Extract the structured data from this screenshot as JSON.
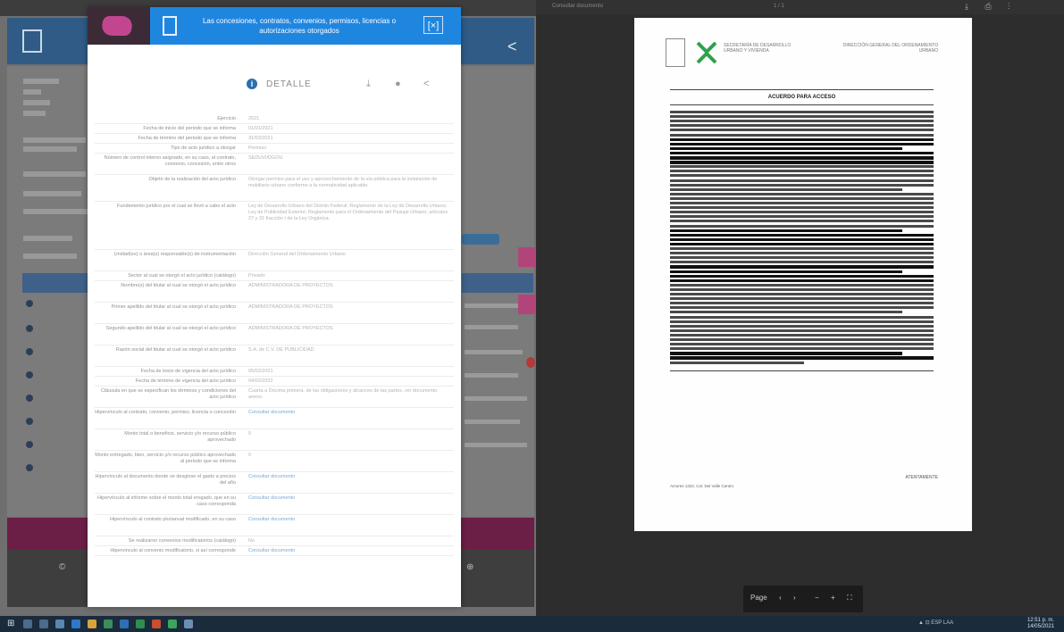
{
  "modal": {
    "title": "Las concesiones, contratos, convenios, permisos, licencias o autorizaciones otorgados",
    "close_label": "[×]",
    "tab_label": "DETALLE",
    "info_icon": "i",
    "share_icon": "<",
    "fields": [
      {
        "label": "Ejercicio",
        "value": "2021",
        "h": 11
      },
      {
        "label": "Fecha de inicio del periodo que se informa",
        "value": "01/01/2021",
        "h": 11
      },
      {
        "label": "Fecha de término del periodo que se informa",
        "value": "31/03/2021",
        "h": 11
      },
      {
        "label": "Tipo de acto jurídico a otorgar",
        "value": "Permiso",
        "h": 11
      },
      {
        "label": "Número de control interno asignado, en su caso, al contrato, convenio, concesión, entre otros",
        "value": "SEDUVI/DGOU",
        "h": 24
      },
      {
        "label": "Objeto de la realización del acto jurídico",
        "value": "Otorgar permiso para el uso y aprovechamiento de la vía pública para la instalación de mobiliario urbano conforme a la normatividad aplicable.",
        "h": 30
      },
      {
        "label": "Fundamento jurídico por el cual se llevó a cabo el acto",
        "value": "Ley de Desarrollo Urbano del Distrito Federal; Reglamento de la Ley de Desarrollo Urbano; Ley de Publicidad Exterior; Reglamento para el Ordenamiento del Paisaje Urbano; artículos 27 y 31 fracción I de la Ley Orgánica.",
        "h": 54
      },
      {
        "label": "Unidad(es) o área(s) responsable(s) de instrumentación",
        "value": "Dirección General del Ordenamiento Urbano",
        "h": 24
      },
      {
        "label": "Sector al cual se otorgó el acto jurídico (catálogo)",
        "value": "Privado",
        "h": 11
      },
      {
        "label": "Nombre(s) del titular al cual se otorgó el acto jurídico",
        "value": "ADMINISTRADORA DE PROYECTOS",
        "h": 24
      },
      {
        "label": "Primer apellido del titular al cual se otorgó el acto jurídico",
        "value": "ADMINISTRADORA DE PROYECTOS",
        "h": 24
      },
      {
        "label": "Segundo apellido del titular al cual se otorgó el acto jurídico",
        "value": "ADMINISTRADORA DE PROYECTOS",
        "h": 24
      },
      {
        "label": "Razón social del titular al cual se otorgó el acto jurídico",
        "value": "S.A. de C.V. DE PUBLICIDAD",
        "h": 24
      },
      {
        "label": "Fecha de inicio de vigencia del acto jurídico",
        "value": "05/02/2021",
        "h": 11
      },
      {
        "label": "Fecha de término de vigencia del acto jurídico",
        "value": "04/02/2022",
        "h": 11
      },
      {
        "label": "Cláusula en que se especifican los términos y condiciones del acto jurídico",
        "value": "Cuarta a Décima primera, de las obligaciones y alcances de las partes, ver documento anexo.",
        "h": 24
      },
      {
        "label": "Hipervínculo al contrato, convenio, permiso, licencia o concesión",
        "value": "Consultar documento",
        "h": 24,
        "link": true
      },
      {
        "label": "Monto total o beneficio, servicio y/o recurso público aprovechado",
        "value": "0",
        "h": 24
      },
      {
        "label": "Monto entregado, bien, servicio y/o recurso público aprovechado al periodo que se informa",
        "value": "0",
        "h": 24
      },
      {
        "label": "Hipervínculo al documento donde se desglose el gasto a precios del año",
        "value": "Consultar documento",
        "h": 24,
        "link": true
      },
      {
        "label": "Hipervínculo al informe sobre el monto total erogado, que en su caso corresponda",
        "value": "Consultar documento",
        "h": 24,
        "link": true
      },
      {
        "label": "Hipervínculo al contrato plurianual modificado, en su caso",
        "value": "Consultar documento",
        "h": 24,
        "link": true
      },
      {
        "label": "Se realizaron convenios modificatorios (catálogo)",
        "value": "No",
        "h": 11
      },
      {
        "label": "Hipervínculo al convenio modificatorio, si así corresponde",
        "value": "Consultar documento",
        "h": 11,
        "link": true
      }
    ]
  },
  "viewer": {
    "title": "Consultar documento",
    "pages": "1 / 1",
    "tools": "⤓ ⎙ ⋮",
    "pdf": {
      "institution": "SECRETARÍA DE DESARROLLO URBANO Y VIVIENDA",
      "reference": "DIRECCIÓN GENERAL DEL ORDENAMIENTO URBANO",
      "heading": "ACUERDO PARA ACCESO",
      "signature": "ATENTAMENTE",
      "address": "Amores 1322, Col. Del Valle Centro"
    },
    "controls": {
      "page": "Page",
      "prev": "‹",
      "next": "›",
      "zoom_out": "−",
      "zoom_in": "+",
      "fit": "⛶"
    }
  },
  "background": {
    "footer_left": "© ",
    "footer_right": "⊕"
  },
  "taskbar": {
    "start": "⊞",
    "tray": "▲ ⊡ ESP LAA",
    "time": "12:51 p. m.",
    "date": "14/05/2021"
  },
  "colors": {
    "modal_header": "#1f86e0",
    "brand_magenta": "#c2468f",
    "background_blue": "#2f5b86",
    "taskbar": "#1a2b3c"
  }
}
